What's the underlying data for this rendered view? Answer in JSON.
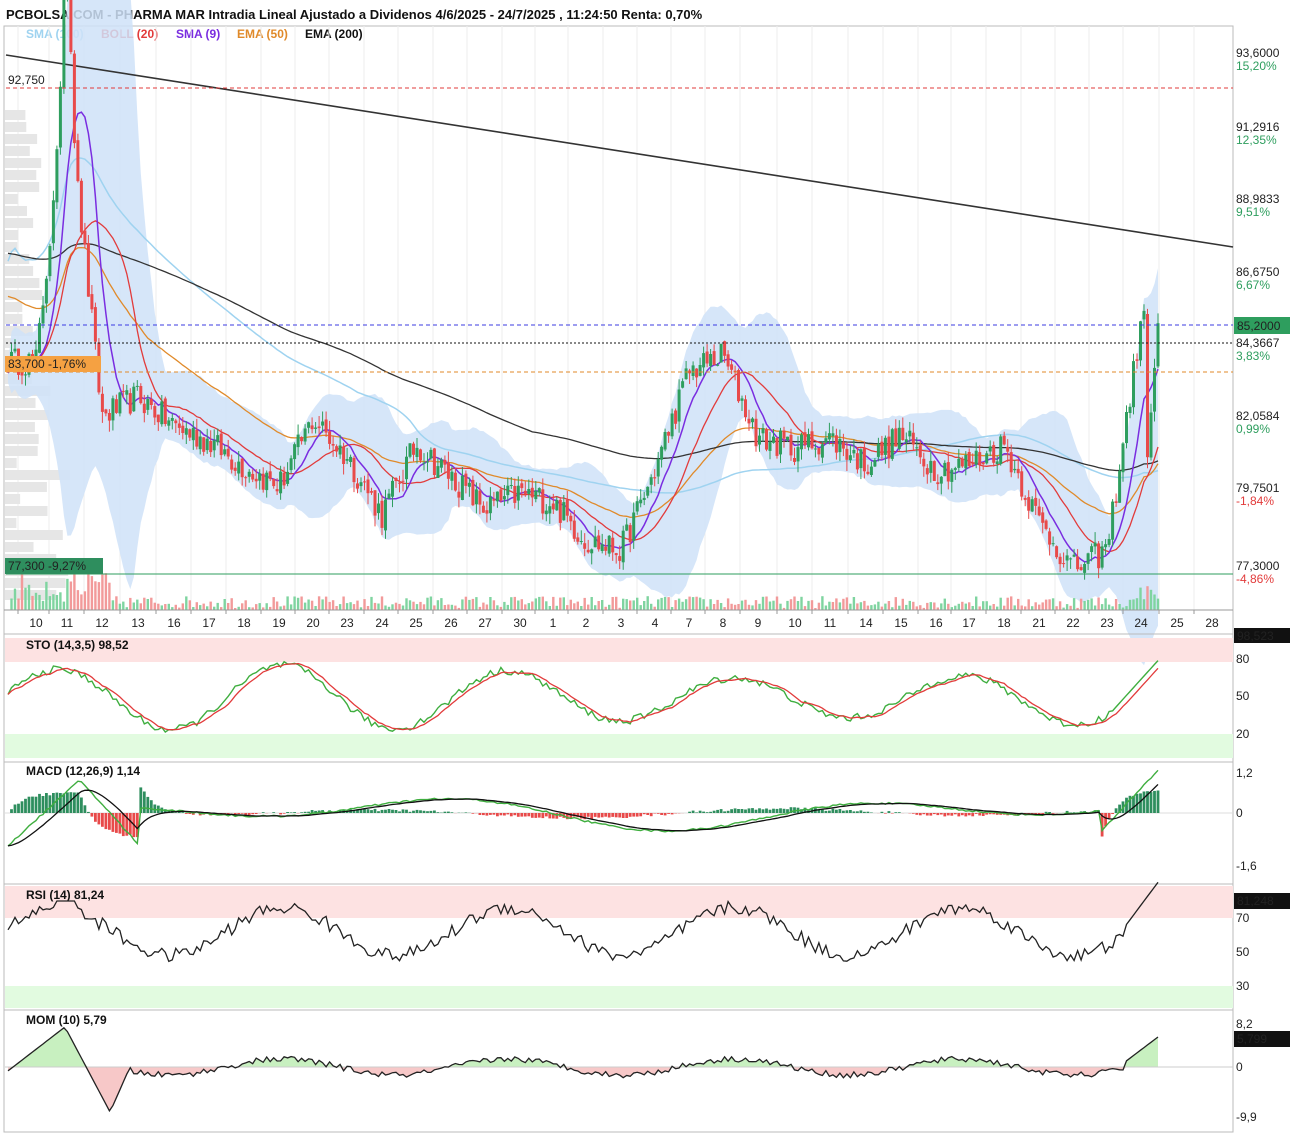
{
  "title": "PCBOLSA.COM - PHARMA MAR Intradia Lineal Ajustado a Dividenos 4/6/2025 - 24/7/2025 , 11:24:50 Renta: 0,70%",
  "legend": [
    {
      "label": "SMA (100)",
      "color": "#9fd3f0"
    },
    {
      "label": "BOLL (20)",
      "color": "#e23b3b"
    },
    {
      "label": "SMA (9)",
      "color": "#7a2de0"
    },
    {
      "label": "EMA (50)",
      "color": "#e08a2a"
    },
    {
      "label": "EMA (200)",
      "color": "#111111"
    }
  ],
  "colors": {
    "up": "#2e9e5e",
    "down": "#e84a4a",
    "boll_fill": "#cfe2f8",
    "ema200": "#333333",
    "sma100": "#9fd3f0",
    "sma9": "#7a2de0",
    "ema50": "#e08a2a",
    "boll_mid": "#e23b3b",
    "stoch_k": "#3fae3f",
    "stoch_d": "#e23b3b",
    "macd_line": "#3fae3f",
    "signal_line": "#111111",
    "overbought_bg": "#fde2e2",
    "oversold_bg": "#e2fbe0"
  },
  "price_axis": {
    "ticks": [
      {
        "value": "93,6000",
        "pct": "15,20%",
        "pct_color": "#2e9e5e"
      },
      {
        "value": "91,2916",
        "pct": "12,35%",
        "pct_color": "#2e9e5e"
      },
      {
        "value": "88,9833",
        "pct": "9,51%",
        "pct_color": "#2e9e5e"
      },
      {
        "value": "86,6750",
        "pct": "6,67%",
        "pct_color": "#2e9e5e"
      },
      {
        "value": "84,3667",
        "pct": "3,83%",
        "pct_color": "#2e9e5e"
      },
      {
        "value": "82,0584",
        "pct": "0,99%",
        "pct_color": "#2e9e5e"
      },
      {
        "value": "79,7501",
        "pct": "-1,84%",
        "pct_color": "#e23b3b"
      },
      {
        "value": "77,3000",
        "pct": "-4,86%",
        "pct_color": "#e23b3b"
      }
    ],
    "last_price": "85,2000",
    "levels": {
      "high": "92,750",
      "mid": "83,700 -1,76%",
      "low": "77,300 -9,27%"
    }
  },
  "x_dates": [
    "10",
    "11",
    "12",
    "13",
    "16",
    "17",
    "18",
    "19",
    "20",
    "23",
    "24",
    "25",
    "26",
    "27",
    "30",
    "1",
    "2",
    "3",
    "4",
    "7",
    "8",
    "9",
    "10",
    "11",
    "14",
    "15",
    "16",
    "17",
    "18",
    "21",
    "22",
    "23",
    "24",
    "25",
    "28"
  ],
  "chart_data": {
    "type": "line",
    "title": "PCBOLSA.COM - PHARMA MAR Intradia Lineal Ajustado a Dividenos 4/6/2025 - 24/7/2025 , 11:24:50 Renta: 0,70%",
    "price_series_close_by_day": {
      "x": [
        "10",
        "11",
        "12",
        "13",
        "16",
        "17",
        "18",
        "19",
        "20",
        "23",
        "24",
        "25",
        "26",
        "27",
        "30",
        "1",
        "2",
        "3",
        "4",
        "7",
        "8",
        "9",
        "10",
        "11",
        "14",
        "15",
        "16",
        "17",
        "18",
        "21",
        "22",
        "23",
        "24"
      ],
      "close": [
        84.0,
        92.5,
        82.3,
        82.9,
        82.0,
        81.5,
        80.7,
        80.1,
        82.2,
        81.0,
        79.2,
        81.4,
        80.4,
        79.4,
        79.9,
        79.6,
        78.4,
        78.1,
        80.6,
        83.7,
        84.2,
        81.6,
        81.3,
        81.6,
        80.8,
        81.7,
        80.6,
        80.8,
        81.4,
        79.0,
        77.5,
        78.1,
        85.2
      ]
    },
    "ylim": [
      76.6,
      94.5
    ],
    "indicators": {
      "STO (14,3,5)": "98,52",
      "MACD (12,26,9)": "1,14",
      "RSI (14)": "81,24",
      "MOM (10)": "5,79"
    }
  },
  "panels": {
    "sto": {
      "label": "STO (14,3,5)",
      "value": "98,52",
      "badge": "98,523",
      "ticks": [
        "80",
        "50",
        "20"
      ]
    },
    "macd": {
      "label": "MACD (12,26,9)",
      "value": "1,14",
      "ticks": [
        "1,2",
        "0",
        "-1,6"
      ]
    },
    "rsi": {
      "label": "RSI (14)",
      "value": "81,24",
      "badge": "81,248",
      "ticks": [
        "70",
        "50",
        "30"
      ]
    },
    "mom": {
      "label": "MOM (10)",
      "value": "5,79",
      "badge": "5,799",
      "ticks": [
        "8,2",
        "0",
        "-9,9"
      ]
    }
  }
}
